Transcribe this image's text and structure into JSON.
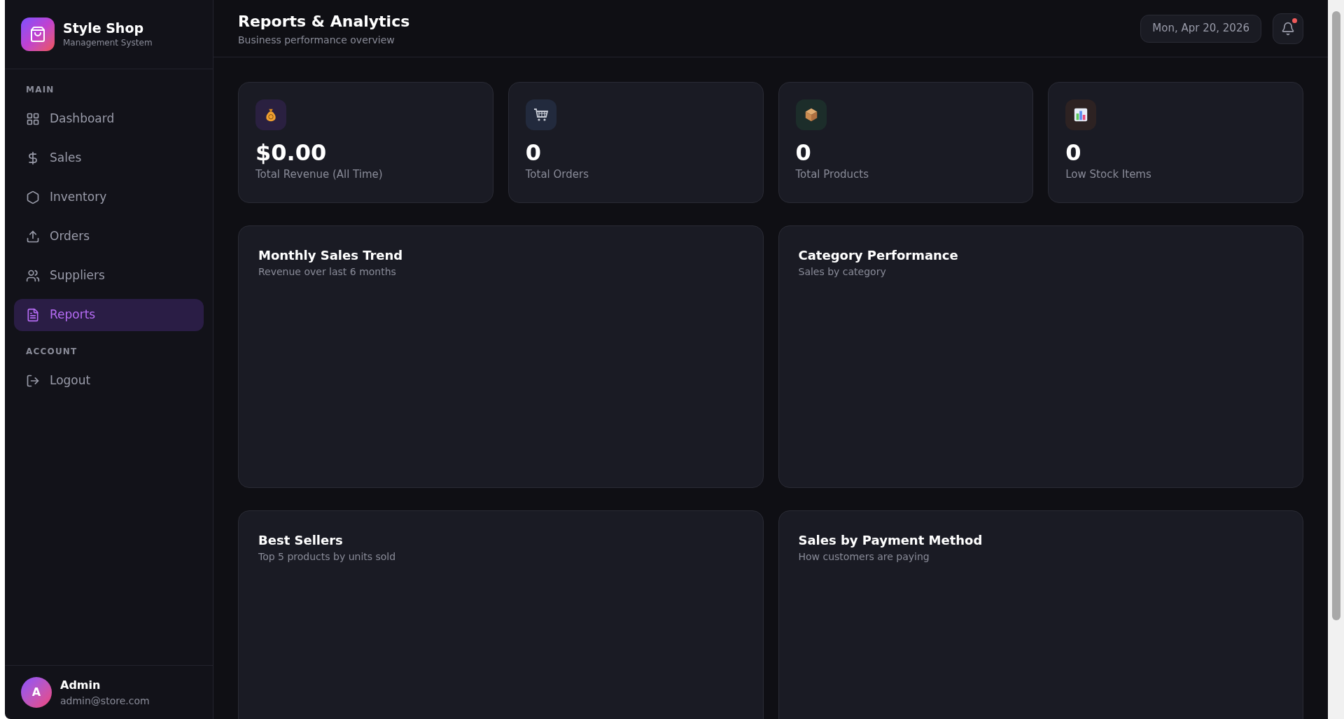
{
  "brand": {
    "name": "Style Shop",
    "subtitle": "Management System"
  },
  "sidebar": {
    "sections": [
      {
        "heading": "MAIN",
        "items": [
          {
            "label": "Dashboard",
            "selected": false
          },
          {
            "label": "Sales",
            "selected": false
          },
          {
            "label": "Inventory",
            "selected": false
          },
          {
            "label": "Orders",
            "selected": false
          },
          {
            "label": "Suppliers",
            "selected": false
          },
          {
            "label": "Reports",
            "selected": true
          }
        ]
      },
      {
        "heading": "ACCOUNT",
        "items": [
          {
            "label": "Logout",
            "selected": false
          }
        ]
      }
    ],
    "user": {
      "initial": "A",
      "name": "Admin",
      "email": "admin@store.com"
    }
  },
  "header": {
    "title": "Reports & Analytics",
    "subtitle": "Business performance overview",
    "date": "Mon, Apr 20, 2026",
    "has_notification": true
  },
  "stats": [
    {
      "value": "$0.00",
      "label": "Total Revenue (All Time)",
      "color": "#2a2040"
    },
    {
      "value": "0",
      "label": "Total Orders",
      "color": "#222a3d"
    },
    {
      "value": "0",
      "label": "Total Products",
      "color": "#1c2d2a"
    },
    {
      "value": "0",
      "label": "Low Stock Items",
      "color": "#2d2222"
    }
  ],
  "panels": [
    {
      "title": "Monthly Sales Trend",
      "subtitle": "Revenue over last 6 months"
    },
    {
      "title": "Category Performance",
      "subtitle": "Sales by category"
    },
    {
      "title": "Best Sellers",
      "subtitle": "Top 5 products by units sold"
    },
    {
      "title": "Sales by Payment Method",
      "subtitle": "How customers are paying"
    }
  ]
}
